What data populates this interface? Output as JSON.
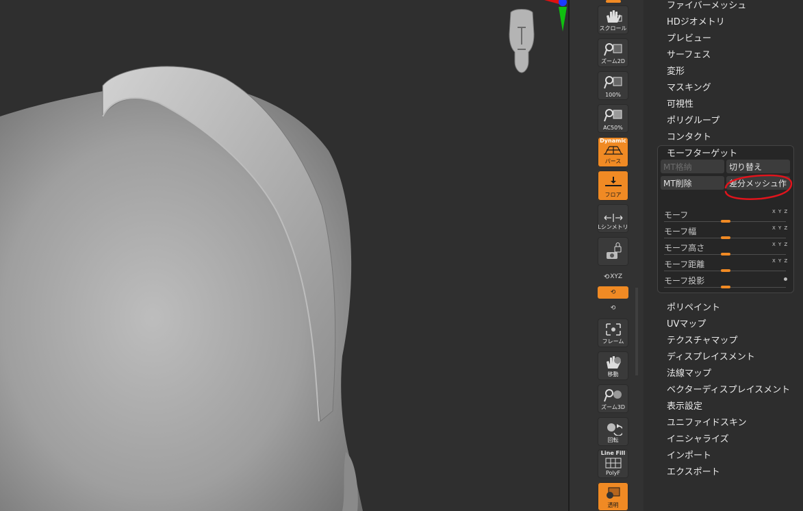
{
  "toolbar": {
    "scroll": "スクロール",
    "zoom2d": "ズーム2D",
    "zoom100": "100%",
    "ac50": "AC50%",
    "dynamic": "Dynamic",
    "perspective": "パース",
    "floor": "フロア",
    "lsym": "Lシンメトリ",
    "xyz": "XYZ",
    "frame": "フレーム",
    "move": "移動",
    "zoom3d": "ズーム3D",
    "rotate": "回転",
    "linefill": "Line Fill",
    "polyf": "PolyF",
    "transparent": "透明"
  },
  "menu_top": [
    "ファイバーメッシュ",
    "HDジオメトリ",
    "プレビュー",
    "サーフェス",
    "変形",
    "マスキング",
    "可視性",
    "ポリグループ",
    "コンタクト"
  ],
  "morph": {
    "title": "モーフターゲット",
    "store": "MT格納",
    "switch": "切り替え",
    "delete": "MT削除",
    "diff": "差分メッシュ作",
    "sliders": [
      "モーフ",
      "モーフ幅",
      "モーフ高さ",
      "モーフ距離",
      "モーフ投影"
    ],
    "xyz_tag": "X Y Z"
  },
  "menu_bottom": [
    "ポリペイント",
    "UVマップ",
    "テクスチャマップ",
    "ディスプレイスメント",
    "法線マップ",
    "ベクターディスプレイスメント",
    "表示設定",
    "ユニファイドスキン",
    "イニシャライズ",
    "インポート",
    "エクスポート"
  ],
  "colors": {
    "accent": "#f08a24",
    "annotation": "#e0141c"
  }
}
